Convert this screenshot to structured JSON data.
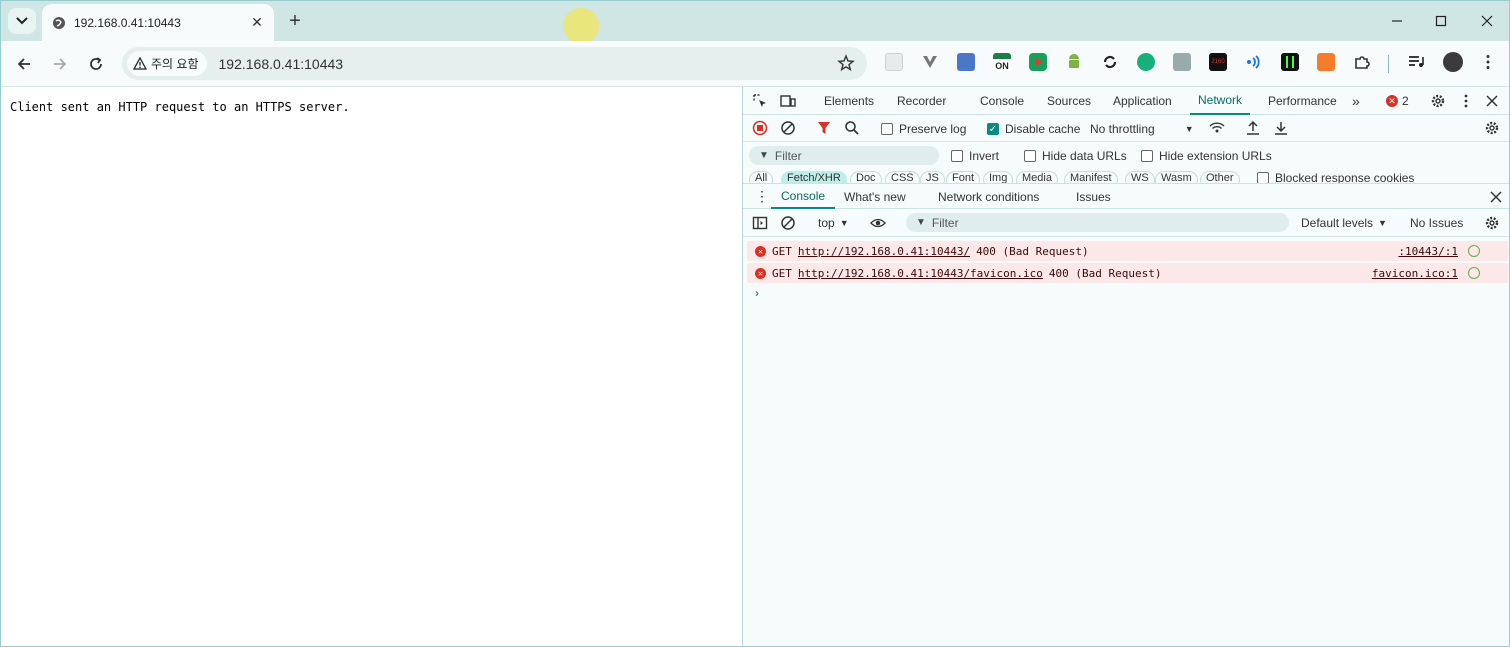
{
  "browser": {
    "tab_title": "192.168.0.41:10443",
    "security_chip": "주의 요함",
    "url": "192.168.0.41:10443",
    "extension_on_label": "ON",
    "extension_number_label": "2160"
  },
  "page": {
    "body_text": "Client sent an HTTP request to an HTTPS server."
  },
  "devtools": {
    "tabs": [
      "Elements",
      "Recorder",
      "Console",
      "Sources",
      "Application",
      "Network",
      "Performance"
    ],
    "active_tab": "Network",
    "error_count": "2",
    "network": {
      "preserve_log": "Preserve log",
      "disable_cache": "Disable cache",
      "throttling": "No throttling",
      "filter_placeholder": "Filter",
      "invert": "Invert",
      "hide_data_urls": "Hide data URLs",
      "hide_extension_urls": "Hide extension URLs",
      "types": [
        "All",
        "Fetch/XHR",
        "Doc",
        "CSS",
        "JS",
        "Font",
        "Img",
        "Media",
        "Manifest",
        "WS",
        "Wasm",
        "Other"
      ],
      "active_type": "Fetch/XHR",
      "blocked_cookies": "Blocked response cookies"
    },
    "drawer": {
      "tabs": [
        "Console",
        "What's new",
        "Network conditions",
        "Issues"
      ],
      "active_tab": "Console"
    },
    "console": {
      "context": "top",
      "filter_placeholder": "Filter",
      "levels": "Default levels",
      "issues": "No Issues",
      "messages": [
        {
          "method": "GET",
          "url": "http://192.168.0.41:10443/",
          "status": "400 (Bad Request)",
          "source": ":10443/:1"
        },
        {
          "method": "GET",
          "url": "http://192.168.0.41:10443/favicon.ico",
          "status": "400 (Bad Request)",
          "source": "favicon.ico:1"
        }
      ]
    }
  },
  "colors": {
    "tabstrip": "#cfe6e4",
    "accent": "#0b8a80",
    "error": "#d93025"
  }
}
